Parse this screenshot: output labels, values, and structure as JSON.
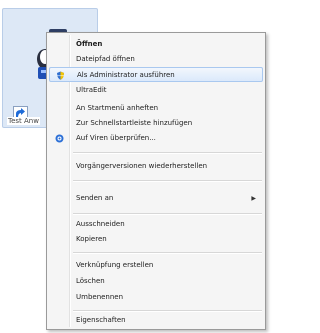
{
  "desktop": {
    "icon_label": "Test Anw",
    "accent": "#dde8f6"
  },
  "context_menu": {
    "items": [
      {
        "label": "Öffnen"
      },
      {
        "label": "Dateipfad öffnen"
      },
      {
        "label": "Als Administrator ausführen",
        "icon": "uac-shield-icon"
      },
      {
        "label": "UltraEdit"
      },
      {
        "label": "An Startmenü anheften"
      },
      {
        "label": "Zur Schnellstartleiste hinzufügen"
      },
      {
        "label": "Auf Viren überprüfen...",
        "icon": "antivirus-icon"
      },
      {
        "label": "Vorgängerversionen wiederherstellen"
      },
      {
        "label": "Senden an",
        "submenu": true
      },
      {
        "label": "Ausschneiden"
      },
      {
        "label": "Kopieren"
      },
      {
        "label": "Verknüpfung erstellen"
      },
      {
        "label": "Löschen"
      },
      {
        "label": "Umbenennen"
      },
      {
        "label": "Eigenschaften"
      }
    ],
    "submenu_arrow": "▶",
    "highlight_color": "#dbe9fb"
  }
}
